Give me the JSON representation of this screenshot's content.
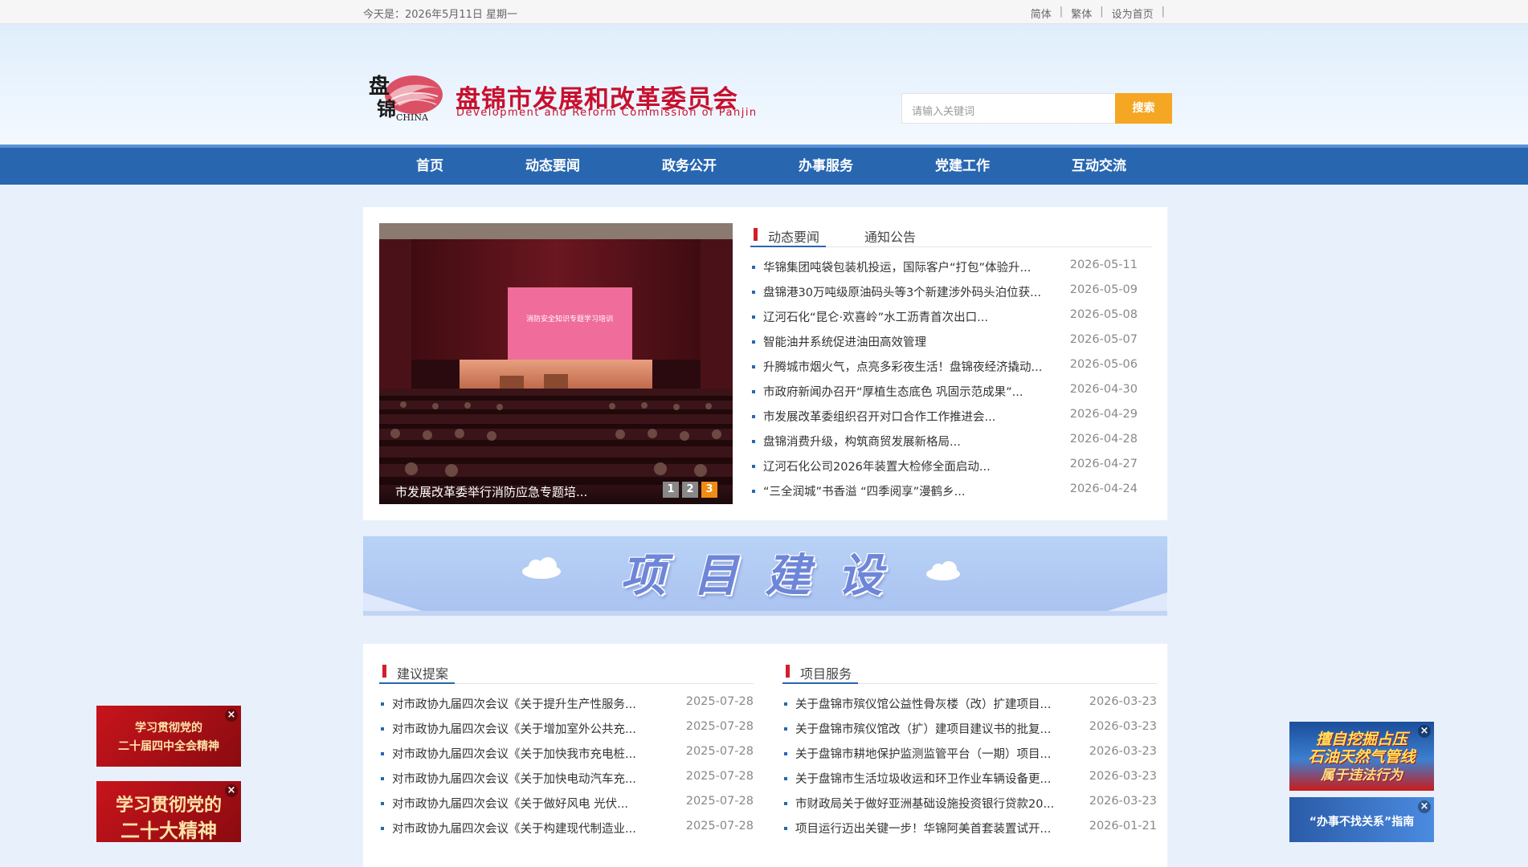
{
  "topbar": {
    "date_text": "今天是：2026年5月11日  星期一",
    "links": [
      "简体",
      "繁体",
      "设为首页"
    ],
    "separator": "|"
  },
  "header": {
    "logo_text": "盘锦 CHINA",
    "title": "盘锦市发展和改革委员会",
    "subtitle": "Development and Reform Commission of Panjin",
    "search_placeholder": "请输入关键词",
    "search_button": "搜索"
  },
  "nav": {
    "items": [
      "首页",
      "动态要闻",
      "政务公开",
      "办事服务",
      "党建工作",
      "互动交流"
    ]
  },
  "slider": {
    "screen_text": "消防安全知识专题学习培训",
    "caption": "市发展改革委举行消防应急专题培...",
    "dots": [
      "1",
      "2",
      "3"
    ],
    "active_dot": 3
  },
  "news_tabs": [
    "动态要闻",
    "通知公告"
  ],
  "news": [
    {
      "title": "华锦集团吨袋包装机投运，国际客户“打包”体验升...",
      "date": "2026-05-11"
    },
    {
      "title": "盘锦港30万吨级原油码头等3个新建涉外码头泊位获...",
      "date": "2026-05-09"
    },
    {
      "title": "辽河石化“昆仑·欢喜岭”水工沥青首次出口...",
      "date": "2026-05-08"
    },
    {
      "title": "智能油井系统促进油田高效管理",
      "date": "2026-05-07"
    },
    {
      "title": "升腾城市烟火气，点亮多彩夜生活！盘锦夜经济撬动...",
      "date": "2026-05-06"
    },
    {
      "title": "市政府新闻办召开“厚植生态底色 巩固示范成果”...",
      "date": "2026-04-30"
    },
    {
      "title": "市发展改革委组织召开对口合作工作推进会...",
      "date": "2026-04-29"
    },
    {
      "title": "盘锦消费升级，构筑商贸发展新格局...",
      "date": "2026-04-28"
    },
    {
      "title": "辽河石化公司2026年装置大检修全面启动...",
      "date": "2026-04-27"
    },
    {
      "title": "“三全润城”书香溢 “四季阅享”漫鹤乡...",
      "date": "2026-04-24"
    }
  ],
  "banner": {
    "text": "项目建设"
  },
  "proposals": {
    "heading": "建议提案",
    "items": [
      {
        "title": "对市政协九届四次会议《关于提升生产性服务...",
        "date": "2025-07-28"
      },
      {
        "title": "对市政协九届四次会议《关于增加室外公共充...",
        "date": "2025-07-28"
      },
      {
        "title": "对市政协九届四次会议《关于加快我市充电桩...",
        "date": "2025-07-28"
      },
      {
        "title": "对市政协九届四次会议《关于加快电动汽车充...",
        "date": "2025-07-28"
      },
      {
        "title": "对市政协九届四次会议《关于做好风电 光伏...",
        "date": "2025-07-28"
      },
      {
        "title": "对市政协九届四次会议《关于构建现代制造业...",
        "date": "2025-07-28"
      }
    ]
  },
  "project_service": {
    "heading": "项目服务",
    "items": [
      {
        "title": "关于盘锦市殡仪馆公益性骨灰楼（改）扩建项目...",
        "date": "2026-03-23"
      },
      {
        "title": "关于盘锦市殡仪馆改（扩）建项目建议书的批复...",
        "date": "2026-03-23"
      },
      {
        "title": "关于盘锦市耕地保护监测监管平台（一期）项目...",
        "date": "2026-03-23"
      },
      {
        "title": "关于盘锦市生活垃圾收运和环卫作业车辆设备更...",
        "date": "2026-03-23"
      },
      {
        "title": "市财政局关于做好亚洲基础设施投资银行贷款20...",
        "date": "2026-03-23"
      },
      {
        "title": "项目运行迈出关键一步！华锦阿美首套装置试开...",
        "date": "2026-01-21"
      }
    ]
  },
  "side_ads": {
    "left_top": {
      "line1": "学习贯彻党的",
      "line2": "二十届四中全会精神"
    },
    "left_bottom": {
      "line1": "学习贯彻党的",
      "line2": "二十大精神"
    },
    "right_top": {
      "line1": "擅自挖掘占压",
      "line2": "石油天然气管线",
      "line3": "属于违法行为"
    },
    "right_bottom": {
      "line1": "“办事不找关系”指南"
    },
    "close_symbol": "×"
  },
  "colors": {
    "nav_blue": "#2866b0",
    "title_red": "#c8102e",
    "search_orange": "#f5a623",
    "active_dot_orange": "#f18b12"
  }
}
